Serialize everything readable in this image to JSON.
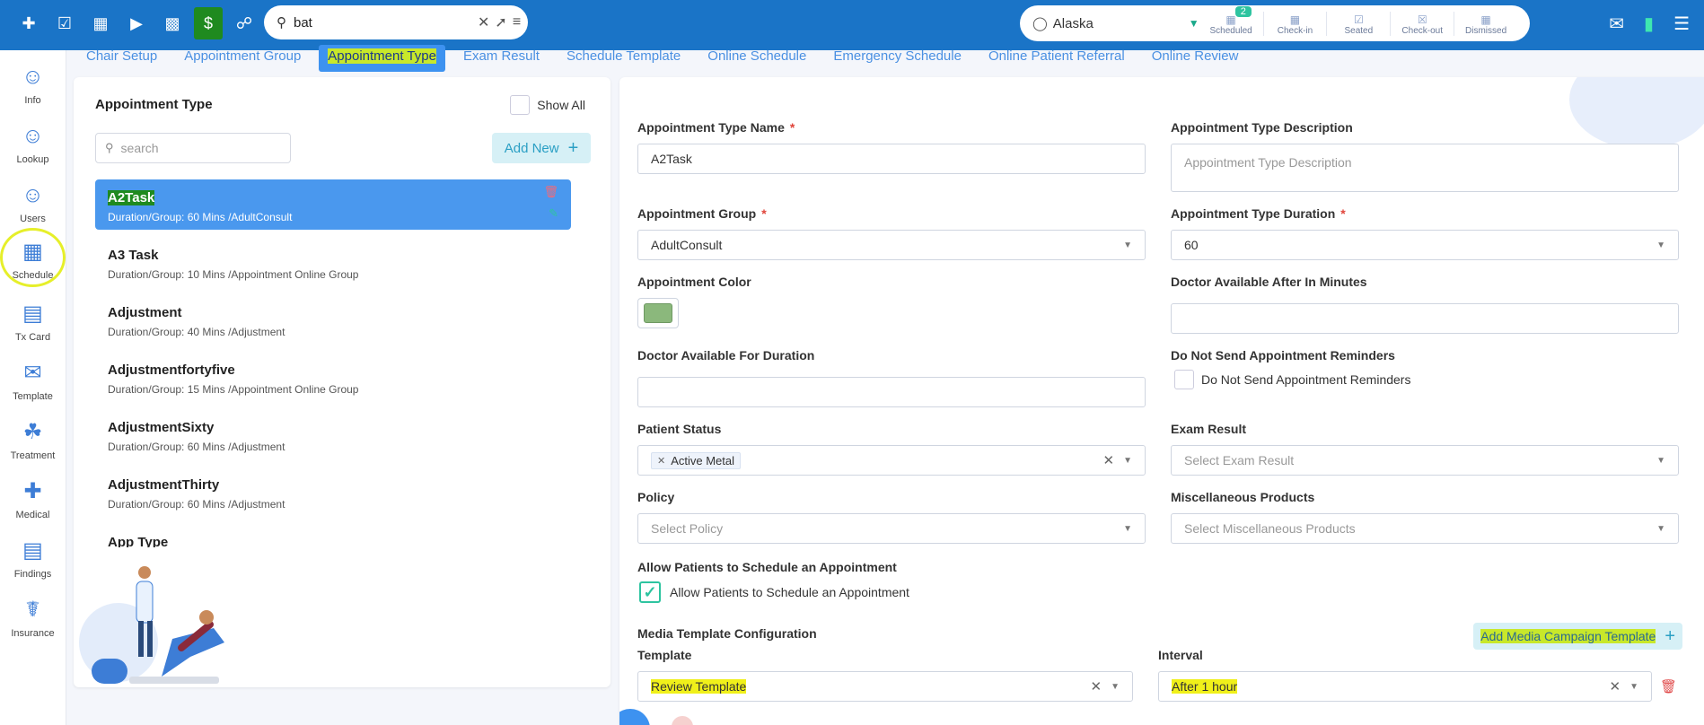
{
  "topbar": {
    "icons": [
      "add-user-icon",
      "calendar-check-icon",
      "dashboard-icon",
      "video-icon",
      "chart-icon",
      "money-icon",
      "shield-file-icon"
    ],
    "search": {
      "value": "bat",
      "placeholder": ""
    },
    "location": "Alaska",
    "statuses": [
      {
        "label": "Scheduled",
        "badge": "2"
      },
      {
        "label": "Check-in"
      },
      {
        "label": "Seated"
      },
      {
        "label": "Check-out"
      },
      {
        "label": "Dismissed"
      }
    ]
  },
  "leftnav": [
    {
      "label": "Info",
      "icon": "person-icon"
    },
    {
      "label": "Lookup",
      "icon": "person-search-icon"
    },
    {
      "label": "Users",
      "icon": "users-icon"
    },
    {
      "label": "Schedule",
      "icon": "schedule-icon"
    },
    {
      "label": "Tx Card",
      "icon": "tx-card-icon"
    },
    {
      "label": "Template",
      "icon": "template-icon"
    },
    {
      "label": "Treatment",
      "icon": "treatment-icon"
    },
    {
      "label": "Medical",
      "icon": "medical-icon"
    },
    {
      "label": "Findings",
      "icon": "findings-icon"
    },
    {
      "label": "Insurance",
      "icon": "insurance-icon"
    }
  ],
  "tabs": [
    {
      "label": "Chair Setup"
    },
    {
      "label": "Appointment Group"
    },
    {
      "label": "Appointment Type",
      "active": true
    },
    {
      "label": "Exam Result"
    },
    {
      "label": "Schedule Template"
    },
    {
      "label": "Online Schedule"
    },
    {
      "label": "Emergency Schedule"
    },
    {
      "label": "Online Patient Referral"
    },
    {
      "label": "Online Review"
    }
  ],
  "left_panel": {
    "title": "Appointment Type",
    "show_all": "Show All",
    "search_placeholder": "search",
    "add_new": "Add New",
    "items": [
      {
        "name": "A2Task",
        "detail": "Duration/Group: 60 Mins /AdultConsult",
        "selected": true
      },
      {
        "name": "A3 Task",
        "detail": "Duration/Group: 10 Mins /Appointment Online Group"
      },
      {
        "name": "Adjustment",
        "detail": "Duration/Group: 40 Mins /Adjustment"
      },
      {
        "name": "Adjustmentfortyfive",
        "detail": "Duration/Group: 15 Mins /Appointment Online Group"
      },
      {
        "name": "AdjustmentSixty",
        "detail": "Duration/Group: 60 Mins /Adjustment"
      },
      {
        "name": "AdjustmentThirty",
        "detail": "Duration/Group: 60 Mins /Adjustment"
      },
      {
        "name": "App Type",
        "detail": ""
      }
    ]
  },
  "form": {
    "type_name_label": "Appointment Type Name",
    "type_name_value": "A2Task",
    "desc_label": "Appointment Type Description",
    "desc_placeholder": "Appointment Type Description",
    "group_label": "Appointment Group",
    "group_value": "AdultConsult",
    "duration_label": "Appointment Type Duration",
    "duration_value": "60",
    "color_label": "Appointment Color",
    "color_value": "#8bb87c",
    "doctor_after_label": "Doctor Available After In Minutes",
    "doctor_for_label": "Doctor Available For Duration",
    "no_reminders_label": "Do Not Send Appointment Reminders",
    "no_reminders_cb": "Do Not Send Appointment Reminders",
    "patient_status_label": "Patient Status",
    "patient_status_tag": "Active Metal",
    "exam_result_label": "Exam Result",
    "exam_result_placeholder": "Select Exam Result",
    "policy_label": "Policy",
    "policy_placeholder": "Select Policy",
    "misc_label": "Miscellaneous Products",
    "misc_placeholder": "Select Miscellaneous Products",
    "allow_label": "Allow Patients to Schedule an Appointment",
    "allow_cb": "Allow Patients to Schedule an Appointment",
    "media_label": "Media Template Configuration",
    "add_media": "Add Media Campaign Template",
    "template_label": "Template",
    "template_value": "Review Template",
    "interval_label": "Interval",
    "interval_value": "After 1 hour"
  }
}
